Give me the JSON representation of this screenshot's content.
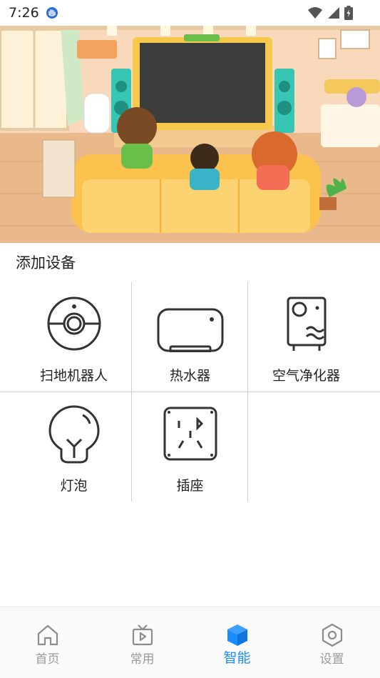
{
  "status_bar": {
    "time": "7:26"
  },
  "section": {
    "title": "添加设备"
  },
  "devices": [
    {
      "label": "扫地机器人",
      "icon": "robot-vacuum-icon"
    },
    {
      "label": "热水器",
      "icon": "water-heater-icon"
    },
    {
      "label": "空气净化器",
      "icon": "air-purifier-icon"
    },
    {
      "label": "灯泡",
      "icon": "light-bulb-icon"
    },
    {
      "label": "插座",
      "icon": "power-socket-icon"
    }
  ],
  "bottom_nav": [
    {
      "label": "首页",
      "icon": "home-icon",
      "active": false
    },
    {
      "label": "常用",
      "icon": "tv-icon",
      "active": false
    },
    {
      "label": "智能",
      "icon": "cube-icon",
      "active": true
    },
    {
      "label": "设置",
      "icon": "hexagon-settings-icon",
      "active": false
    }
  ],
  "colors": {
    "accent": "#1a8cff",
    "nav_inactive": "#9a9a9a",
    "divider": "#cfcfcf"
  }
}
